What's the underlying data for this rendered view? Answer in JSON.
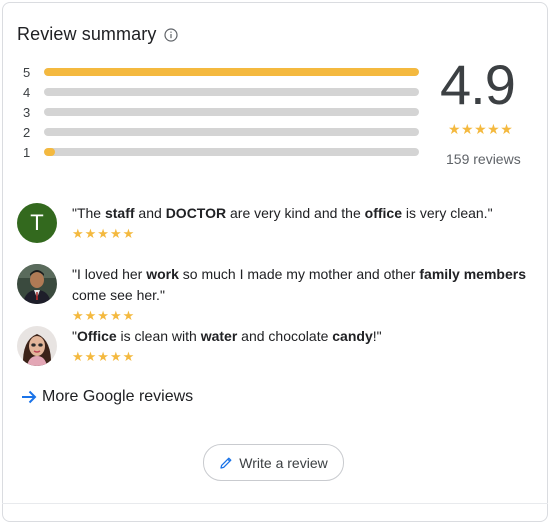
{
  "header": {
    "title": "Review summary",
    "info_icon": "info-icon"
  },
  "distribution": [
    {
      "label": "5",
      "fraction": 1.0
    },
    {
      "label": "4",
      "fraction": 0.0
    },
    {
      "label": "3",
      "fraction": 0.0
    },
    {
      "label": "2",
      "fraction": 0.0
    },
    {
      "label": "1",
      "fraction": 0.03
    }
  ],
  "rating": {
    "score": "4.9",
    "stars": "★★★★★",
    "count_text": "159 reviews"
  },
  "reviews": [
    {
      "avatar_letter": "T",
      "text_parts": [
        {
          "t": "\"The ",
          "b": false
        },
        {
          "t": "staff",
          "b": true
        },
        {
          "t": " and ",
          "b": false
        },
        {
          "t": "DOCTOR",
          "b": true
        },
        {
          "t": " are very kind and the ",
          "b": false
        },
        {
          "t": "office",
          "b": true
        },
        {
          "t": " is very clean.\"",
          "b": false
        }
      ],
      "stars": "★★★★★"
    },
    {
      "avatar_letter": "",
      "text_parts": [
        {
          "t": "\"I loved her ",
          "b": false
        },
        {
          "t": "work",
          "b": true
        },
        {
          "t": " so much I made my mother and other ",
          "b": false
        },
        {
          "t": "family members",
          "b": true
        },
        {
          "t": " come see her.\"",
          "b": false
        }
      ],
      "stars": "★★★★★"
    },
    {
      "avatar_letter": "",
      "text_parts": [
        {
          "t": "\"",
          "b": false
        },
        {
          "t": "Office",
          "b": true
        },
        {
          "t": " is clean with ",
          "b": false
        },
        {
          "t": "water",
          "b": true
        },
        {
          "t": " and chocolate ",
          "b": false
        },
        {
          "t": "candy",
          "b": true
        },
        {
          "t": "!\"",
          "b": false
        }
      ],
      "stars": "★★★★★"
    }
  ],
  "more_link": {
    "label": "More Google reviews",
    "icon": "arrow-right-icon"
  },
  "write_button": {
    "label": "Write a review",
    "icon": "pencil-icon"
  },
  "colors": {
    "star": "#f4b93f",
    "bar_bg": "#d4d4d4",
    "link_blue": "#1a73e8",
    "avatar_green": "#33691e"
  }
}
